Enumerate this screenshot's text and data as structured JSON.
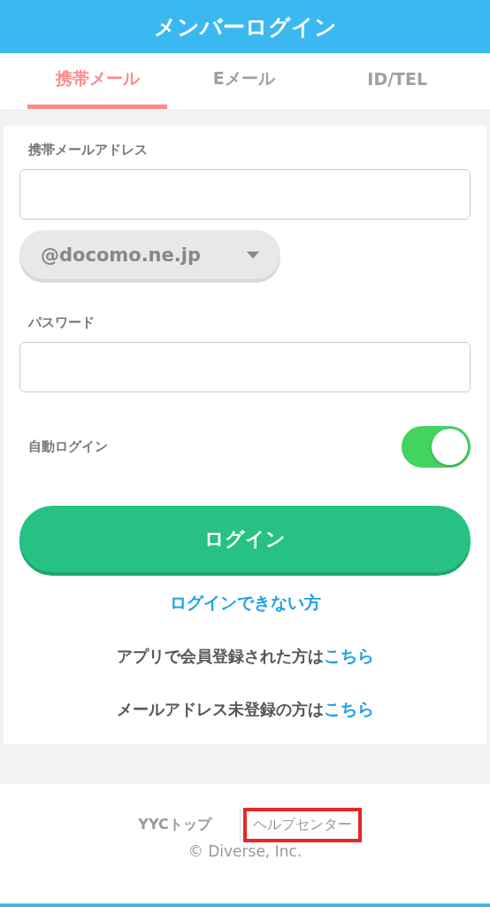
{
  "header": {
    "title": "メンバーログイン"
  },
  "tabs": [
    {
      "label": "携帯メール",
      "selected": true
    },
    {
      "label": "Eメール",
      "selected": false
    },
    {
      "label": "ID/TEL",
      "selected": false
    }
  ],
  "form": {
    "email_label": "携帯メールアドレス",
    "domain": "@docomo.ne.jp",
    "password_label": "パスワード",
    "auto_login": {
      "label": "自動ログイン",
      "on": true
    },
    "login_button": "ログイン",
    "forgot_link": "ログインできない方"
  },
  "notes": [
    {
      "text": "アプリで会員登録された方は",
      "link": "こちら"
    },
    {
      "text": "メールアドレス未登録の方は",
      "link": "こちら"
    }
  ],
  "footer": {
    "links": [
      {
        "label": "YYCトップ",
        "highlighted": false
      },
      {
        "label": "ヘルプセンター",
        "highlighted": true
      }
    ],
    "copyright": "© Diverse, Inc."
  }
}
